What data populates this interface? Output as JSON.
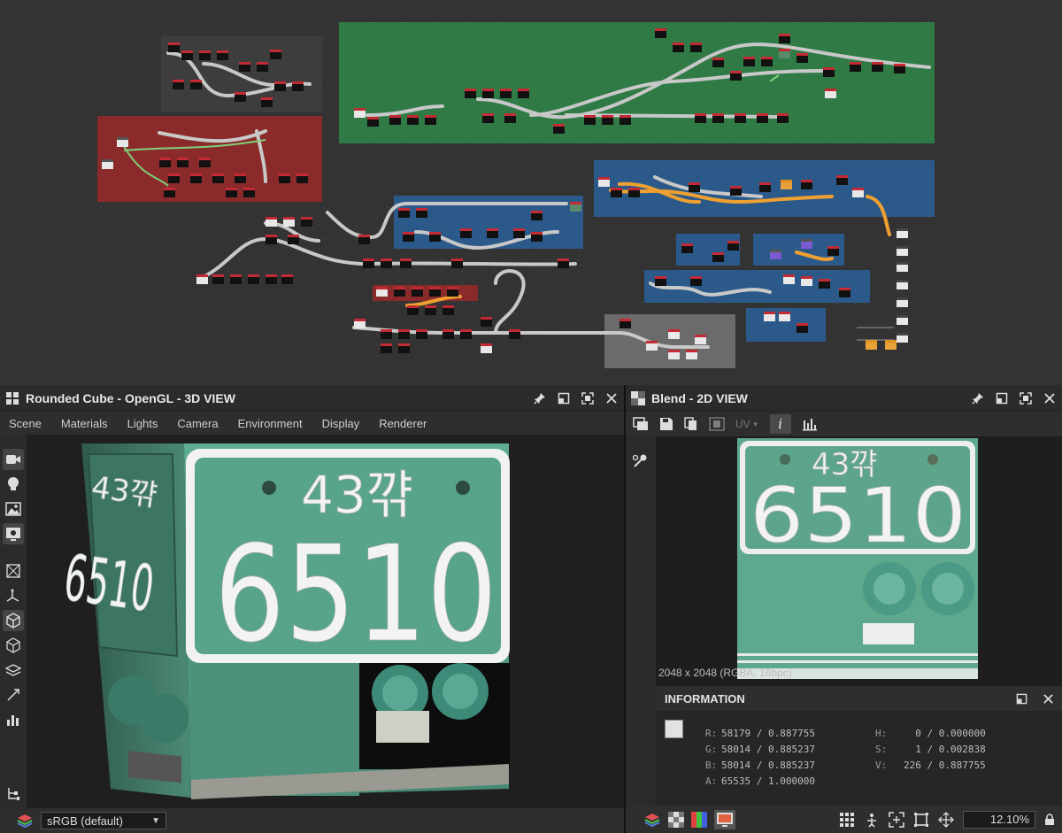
{
  "graph": {
    "frames": [
      {
        "title": "",
        "color": "#3d3d3d"
      },
      {
        "title": "",
        "color": "#2f7a45"
      },
      {
        "title": "",
        "color": "#8b2a2a"
      },
      {
        "title": "",
        "color": "#2b5a8a"
      },
      {
        "title": "",
        "color": "#6b6b6b"
      }
    ]
  },
  "viewport3d": {
    "title": "Rounded Cube - OpenGL - 3D VIEW",
    "menu": [
      "Scene",
      "Materials",
      "Lights",
      "Camera",
      "Environment",
      "Display",
      "Renderer"
    ],
    "colorspace": "sRGB (default)",
    "plate_top": "43꺆",
    "plate_number": "6510",
    "side_number": "6510",
    "side_top": "43꺆"
  },
  "viewport2d": {
    "title": "Blend - 2D VIEW",
    "uv_label": "UV",
    "resolution_text": "2048 x 2048 (RGBA, 16bpc)",
    "plate_top": "43꺆",
    "plate_number": "6510",
    "zoom": "12.10%"
  },
  "information": {
    "title": "INFORMATION",
    "swatch_color": "#e2e2e2",
    "rows": [
      {
        "k1": "R:",
        "v1": "58179 / 0.887755",
        "k2": "H:",
        "v2": "  0 / 0.000000"
      },
      {
        "k1": "G:",
        "v1": "58014 / 0.885237",
        "k2": "S:",
        "v2": "  1 / 0.002838"
      },
      {
        "k1": "B:",
        "v1": "58014 / 0.885237",
        "k2": "V:",
        "v2": "226 / 0.887755"
      },
      {
        "k1": "A:",
        "v1": "65535 / 1.000000",
        "k2": "",
        "v2": ""
      }
    ]
  },
  "colors": {
    "plate_green": "#5ea88e",
    "wire": "#c8c8c8",
    "wire_active": "#f0a030"
  }
}
